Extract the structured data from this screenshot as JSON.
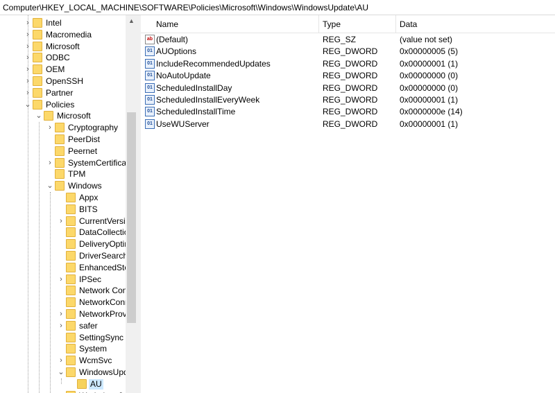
{
  "address": {
    "path": "Computer\\HKEY_LOCAL_MACHINE\\SOFTWARE\\Policies\\Microsoft\\Windows\\WindowsUpdate\\AU"
  },
  "tree": {
    "items": [
      {
        "label": "Intel",
        "indent": 0,
        "expander": ">"
      },
      {
        "label": "Macromedia",
        "indent": 0,
        "expander": ">"
      },
      {
        "label": "Microsoft",
        "indent": 0,
        "expander": ">"
      },
      {
        "label": "ODBC",
        "indent": 0,
        "expander": ">"
      },
      {
        "label": "OEM",
        "indent": 0,
        "expander": ">"
      },
      {
        "label": "OpenSSH",
        "indent": 0,
        "expander": ">"
      },
      {
        "label": "Partner",
        "indent": 0,
        "expander": ">"
      },
      {
        "label": "Policies",
        "indent": 0,
        "expander": "v"
      },
      {
        "label": "Microsoft",
        "indent": 1,
        "expander": "v"
      },
      {
        "label": "Cryptography",
        "indent": 2,
        "expander": ">"
      },
      {
        "label": "PeerDist",
        "indent": 2,
        "expander": ""
      },
      {
        "label": "Peernet",
        "indent": 2,
        "expander": ""
      },
      {
        "label": "SystemCertificate",
        "indent": 2,
        "expander": ">"
      },
      {
        "label": "TPM",
        "indent": 2,
        "expander": ""
      },
      {
        "label": "Windows",
        "indent": 2,
        "expander": "v"
      },
      {
        "label": "Appx",
        "indent": 3,
        "expander": ""
      },
      {
        "label": "BITS",
        "indent": 3,
        "expander": ""
      },
      {
        "label": "CurrentVersion",
        "indent": 3,
        "expander": ">"
      },
      {
        "label": "DataCollection",
        "indent": 3,
        "expander": ""
      },
      {
        "label": "DeliveryOptim",
        "indent": 3,
        "expander": ""
      },
      {
        "label": "DriverSearchin",
        "indent": 3,
        "expander": ""
      },
      {
        "label": "EnhancedStora",
        "indent": 3,
        "expander": ""
      },
      {
        "label": "IPSec",
        "indent": 3,
        "expander": ">"
      },
      {
        "label": "Network Conn",
        "indent": 3,
        "expander": ""
      },
      {
        "label": "NetworkConne",
        "indent": 3,
        "expander": ""
      },
      {
        "label": "NetworkProvic",
        "indent": 3,
        "expander": ">"
      },
      {
        "label": "safer",
        "indent": 3,
        "expander": ">"
      },
      {
        "label": "SettingSync",
        "indent": 3,
        "expander": ""
      },
      {
        "label": "System",
        "indent": 3,
        "expander": ""
      },
      {
        "label": "WcmSvc",
        "indent": 3,
        "expander": ">"
      },
      {
        "label": "WindowsUpda",
        "indent": 3,
        "expander": "v"
      },
      {
        "label": "AU",
        "indent": 4,
        "expander": "",
        "selected": true
      },
      {
        "label": "WorkplaceJoin",
        "indent": 3,
        "expander": ""
      }
    ]
  },
  "list": {
    "headers": {
      "name": "Name",
      "type": "Type",
      "data": "Data"
    },
    "rows": [
      {
        "name": "(Default)",
        "type": "REG_SZ",
        "data": "(value not set)",
        "icon": "string-value-icon"
      },
      {
        "name": "AUOptions",
        "type": "REG_DWORD",
        "data": "0x00000005 (5)",
        "icon": "dword-value-icon"
      },
      {
        "name": "IncludeRecommendedUpdates",
        "type": "REG_DWORD",
        "data": "0x00000001 (1)",
        "icon": "dword-value-icon"
      },
      {
        "name": "NoAutoUpdate",
        "type": "REG_DWORD",
        "data": "0x00000000 (0)",
        "icon": "dword-value-icon"
      },
      {
        "name": "ScheduledInstallDay",
        "type": "REG_DWORD",
        "data": "0x00000000 (0)",
        "icon": "dword-value-icon"
      },
      {
        "name": "ScheduledInstallEveryWeek",
        "type": "REG_DWORD",
        "data": "0x00000001 (1)",
        "icon": "dword-value-icon"
      },
      {
        "name": "ScheduledInstallTime",
        "type": "REG_DWORD",
        "data": "0x0000000e (14)",
        "icon": "dword-value-icon"
      },
      {
        "name": "UseWUServer",
        "type": "REG_DWORD",
        "data": "0x00000001 (1)",
        "icon": "dword-value-icon"
      }
    ]
  },
  "colors": {
    "selection": "#cce8ff",
    "folder": "#fcd86a"
  }
}
